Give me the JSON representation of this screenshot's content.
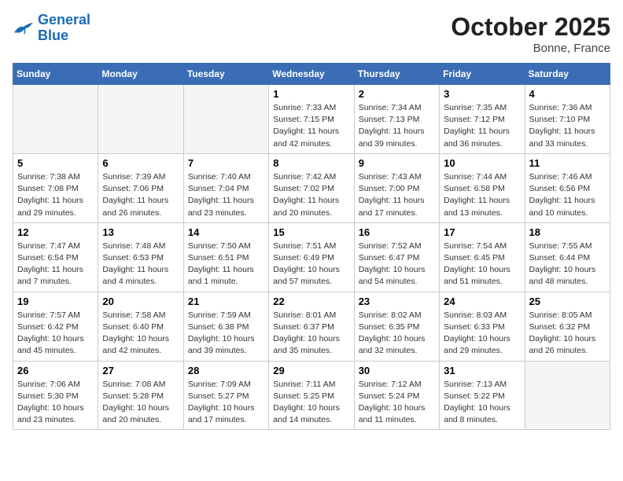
{
  "header": {
    "logo_line1": "General",
    "logo_line2": "Blue",
    "month": "October 2025",
    "location": "Bonne, France"
  },
  "days_of_week": [
    "Sunday",
    "Monday",
    "Tuesday",
    "Wednesday",
    "Thursday",
    "Friday",
    "Saturday"
  ],
  "weeks": [
    [
      {
        "day": "",
        "info": ""
      },
      {
        "day": "",
        "info": ""
      },
      {
        "day": "",
        "info": ""
      },
      {
        "day": "1",
        "info": "Sunrise: 7:33 AM\nSunset: 7:15 PM\nDaylight: 11 hours and 42 minutes."
      },
      {
        "day": "2",
        "info": "Sunrise: 7:34 AM\nSunset: 7:13 PM\nDaylight: 11 hours and 39 minutes."
      },
      {
        "day": "3",
        "info": "Sunrise: 7:35 AM\nSunset: 7:12 PM\nDaylight: 11 hours and 36 minutes."
      },
      {
        "day": "4",
        "info": "Sunrise: 7:36 AM\nSunset: 7:10 PM\nDaylight: 11 hours and 33 minutes."
      }
    ],
    [
      {
        "day": "5",
        "info": "Sunrise: 7:38 AM\nSunset: 7:08 PM\nDaylight: 11 hours and 29 minutes."
      },
      {
        "day": "6",
        "info": "Sunrise: 7:39 AM\nSunset: 7:06 PM\nDaylight: 11 hours and 26 minutes."
      },
      {
        "day": "7",
        "info": "Sunrise: 7:40 AM\nSunset: 7:04 PM\nDaylight: 11 hours and 23 minutes."
      },
      {
        "day": "8",
        "info": "Sunrise: 7:42 AM\nSunset: 7:02 PM\nDaylight: 11 hours and 20 minutes."
      },
      {
        "day": "9",
        "info": "Sunrise: 7:43 AM\nSunset: 7:00 PM\nDaylight: 11 hours and 17 minutes."
      },
      {
        "day": "10",
        "info": "Sunrise: 7:44 AM\nSunset: 6:58 PM\nDaylight: 11 hours and 13 minutes."
      },
      {
        "day": "11",
        "info": "Sunrise: 7:46 AM\nSunset: 6:56 PM\nDaylight: 11 hours and 10 minutes."
      }
    ],
    [
      {
        "day": "12",
        "info": "Sunrise: 7:47 AM\nSunset: 6:54 PM\nDaylight: 11 hours and 7 minutes."
      },
      {
        "day": "13",
        "info": "Sunrise: 7:48 AM\nSunset: 6:53 PM\nDaylight: 11 hours and 4 minutes."
      },
      {
        "day": "14",
        "info": "Sunrise: 7:50 AM\nSunset: 6:51 PM\nDaylight: 11 hours and 1 minute."
      },
      {
        "day": "15",
        "info": "Sunrise: 7:51 AM\nSunset: 6:49 PM\nDaylight: 10 hours and 57 minutes."
      },
      {
        "day": "16",
        "info": "Sunrise: 7:52 AM\nSunset: 6:47 PM\nDaylight: 10 hours and 54 minutes."
      },
      {
        "day": "17",
        "info": "Sunrise: 7:54 AM\nSunset: 6:45 PM\nDaylight: 10 hours and 51 minutes."
      },
      {
        "day": "18",
        "info": "Sunrise: 7:55 AM\nSunset: 6:44 PM\nDaylight: 10 hours and 48 minutes."
      }
    ],
    [
      {
        "day": "19",
        "info": "Sunrise: 7:57 AM\nSunset: 6:42 PM\nDaylight: 10 hours and 45 minutes."
      },
      {
        "day": "20",
        "info": "Sunrise: 7:58 AM\nSunset: 6:40 PM\nDaylight: 10 hours and 42 minutes."
      },
      {
        "day": "21",
        "info": "Sunrise: 7:59 AM\nSunset: 6:38 PM\nDaylight: 10 hours and 39 minutes."
      },
      {
        "day": "22",
        "info": "Sunrise: 8:01 AM\nSunset: 6:37 PM\nDaylight: 10 hours and 35 minutes."
      },
      {
        "day": "23",
        "info": "Sunrise: 8:02 AM\nSunset: 6:35 PM\nDaylight: 10 hours and 32 minutes."
      },
      {
        "day": "24",
        "info": "Sunrise: 8:03 AM\nSunset: 6:33 PM\nDaylight: 10 hours and 29 minutes."
      },
      {
        "day": "25",
        "info": "Sunrise: 8:05 AM\nSunset: 6:32 PM\nDaylight: 10 hours and 26 minutes."
      }
    ],
    [
      {
        "day": "26",
        "info": "Sunrise: 7:06 AM\nSunset: 5:30 PM\nDaylight: 10 hours and 23 minutes."
      },
      {
        "day": "27",
        "info": "Sunrise: 7:08 AM\nSunset: 5:28 PM\nDaylight: 10 hours and 20 minutes."
      },
      {
        "day": "28",
        "info": "Sunrise: 7:09 AM\nSunset: 5:27 PM\nDaylight: 10 hours and 17 minutes."
      },
      {
        "day": "29",
        "info": "Sunrise: 7:11 AM\nSunset: 5:25 PM\nDaylight: 10 hours and 14 minutes."
      },
      {
        "day": "30",
        "info": "Sunrise: 7:12 AM\nSunset: 5:24 PM\nDaylight: 10 hours and 11 minutes."
      },
      {
        "day": "31",
        "info": "Sunrise: 7:13 AM\nSunset: 5:22 PM\nDaylight: 10 hours and 8 minutes."
      },
      {
        "day": "",
        "info": ""
      }
    ]
  ]
}
